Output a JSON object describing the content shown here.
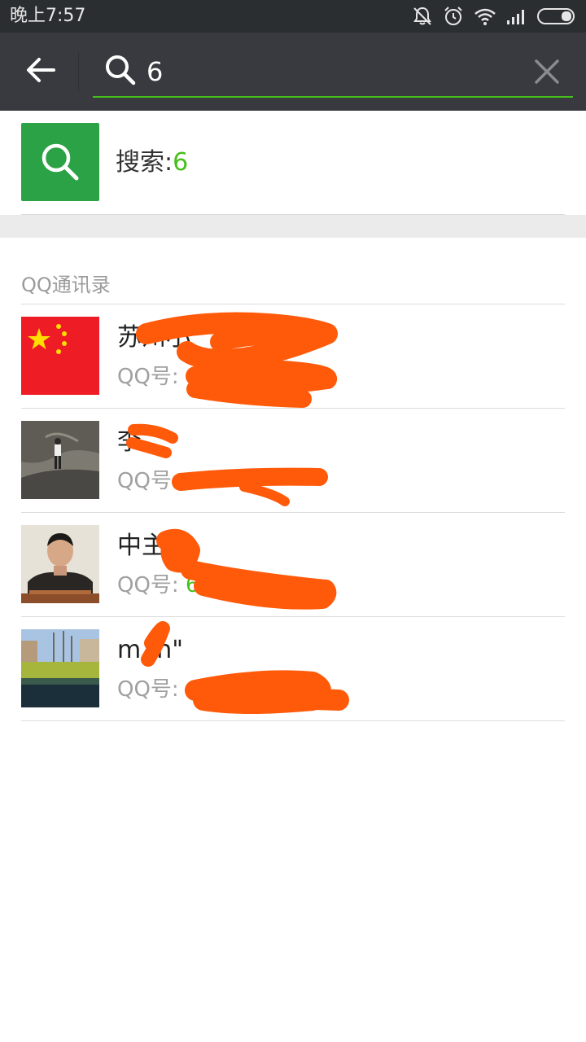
{
  "status_bar": {
    "time": "晚上7:57",
    "icons": [
      "mute-icon",
      "alarm-icon",
      "wifi-icon",
      "signal-icon",
      "battery-icon"
    ]
  },
  "header": {
    "back_icon": "arrow-left-icon",
    "search_icon": "search-icon",
    "query": "6",
    "clear_icon": "close-icon"
  },
  "suggestion": {
    "label": "搜索:",
    "query": "6"
  },
  "section": {
    "title": "QQ通讯录"
  },
  "contacts": [
    {
      "name": "苏州小",
      "qq_label": "QQ号: ",
      "qq_value": "6",
      "avatar": "china-flag"
    },
    {
      "name": "李",
      "qq_label": "QQ号",
      "qq_value": "",
      "avatar": "person-on-rock-photo"
    },
    {
      "name": "中主",
      "qq_label": "QQ号: ",
      "qq_value": "6",
      "avatar": "man-portrait-photo"
    },
    {
      "name": "m  n\"",
      "qq_label": "QQ号: ",
      "qq_value": "6",
      "avatar": "lake-landscape-photo"
    }
  ],
  "colors": {
    "status_bar": "#2b2e31",
    "header": "#393a3f",
    "accent_green": "#45c01a",
    "search_box_green": "#2ba245",
    "redaction": "#ff5a0a"
  }
}
